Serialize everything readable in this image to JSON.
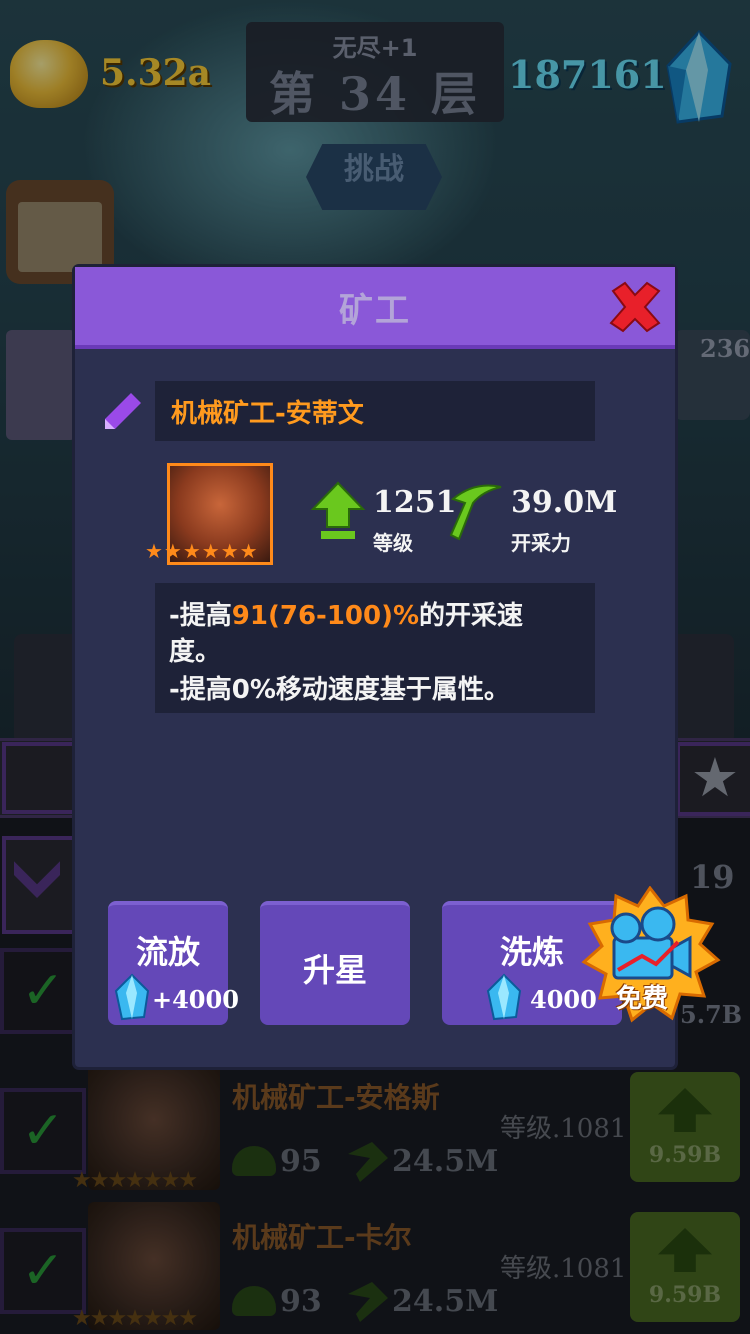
{
  "topbar": {
    "gold_value": "5.32a",
    "floor_mode": "无尽+1",
    "floor_label": "第 34 层",
    "gem_value": "187161",
    "challenge_label": "挑战",
    "right_badge_count": "236"
  },
  "background_list": {
    "count_19": "19",
    "rows": [
      {
        "name": "机械矿工-安格斯",
        "level": "等级.1081",
        "helmet_stat": "95",
        "pick_stat": "24.5M",
        "upgrade_price": "9.59B"
      },
      {
        "name": "机械矿工-卡尔",
        "level": "等级.1081",
        "helmet_stat": "93",
        "pick_stat": "24.5M",
        "upgrade_price": "9.59B"
      }
    ],
    "partial_price": "5.7B"
  },
  "modal": {
    "title": "矿工",
    "miner_name": "机械矿工-安蒂文",
    "stars": "★★★★★★",
    "level_value": "1251",
    "level_label": "等级",
    "power_value": "39.0M",
    "power_label": "开采力",
    "desc": {
      "line1_prefix": "-提高",
      "line1_highlight": "91(76-100)%",
      "line1_suffix": "的开采速",
      "line2": "度。",
      "line3": "-提高0%移动速度基于属性。"
    },
    "buttons": {
      "exile_label": "流放",
      "exile_cost": "+4000",
      "star_up_label": "升星",
      "refine_label": "洗炼",
      "refine_cost": "4000",
      "free_label": "免费"
    }
  },
  "colors": {
    "modal_header": "#8a58d8",
    "modal_body": "#2c3050",
    "highlight": "#ff8a1a",
    "button": "#6448b8",
    "close": "#e8202a"
  }
}
